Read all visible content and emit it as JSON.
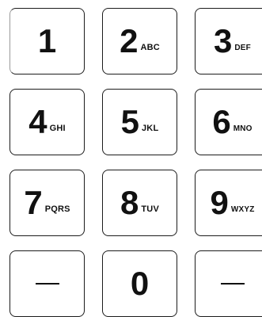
{
  "keypad": {
    "keys": [
      {
        "digit": "1",
        "letters": ""
      },
      {
        "digit": "2",
        "letters": "ABC"
      },
      {
        "digit": "3",
        "letters": "DEF"
      },
      {
        "digit": "4",
        "letters": "GHI"
      },
      {
        "digit": "5",
        "letters": "JKL"
      },
      {
        "digit": "6",
        "letters": "MNO"
      },
      {
        "digit": "7",
        "letters": "PQRS"
      },
      {
        "digit": "8",
        "letters": "TUV"
      },
      {
        "digit": "9",
        "letters": "WXYZ"
      },
      {
        "symbol": "dash-icon"
      },
      {
        "digit": "0",
        "letters": ""
      },
      {
        "symbol": "dash-icon"
      }
    ]
  }
}
